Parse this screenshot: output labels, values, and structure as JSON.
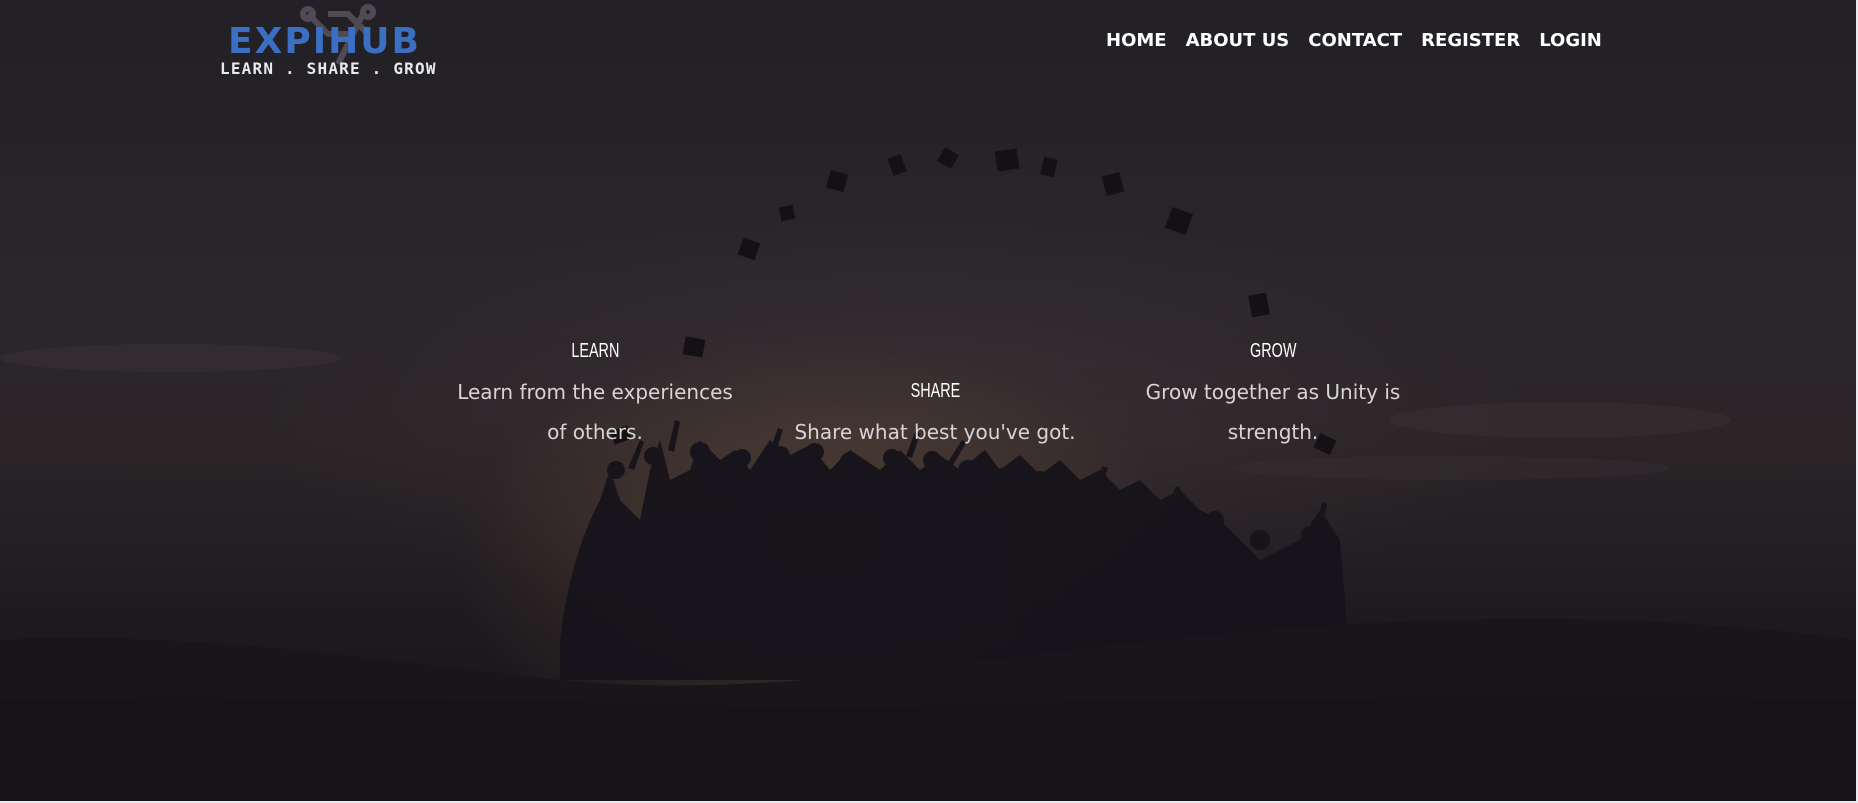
{
  "brand": {
    "name": "EXPIHUB",
    "tagline": "LEARN . SHARE . GROW",
    "accent_color": "#3a6fc4"
  },
  "nav": {
    "items": [
      {
        "label": "HOME"
      },
      {
        "label": "ABOUT US"
      },
      {
        "label": "CONTACT"
      },
      {
        "label": "REGISTER"
      },
      {
        "label": "LOGIN"
      }
    ]
  },
  "features": [
    {
      "title": "LEARN",
      "text": "Learn from the experiences of others."
    },
    {
      "title": "SHARE",
      "text": "Share what best you've got."
    },
    {
      "title": "GROW",
      "text": "Grow together as Unity is strength."
    }
  ],
  "hero": {
    "background_image": "graduates-silhouette-throwing-caps"
  }
}
